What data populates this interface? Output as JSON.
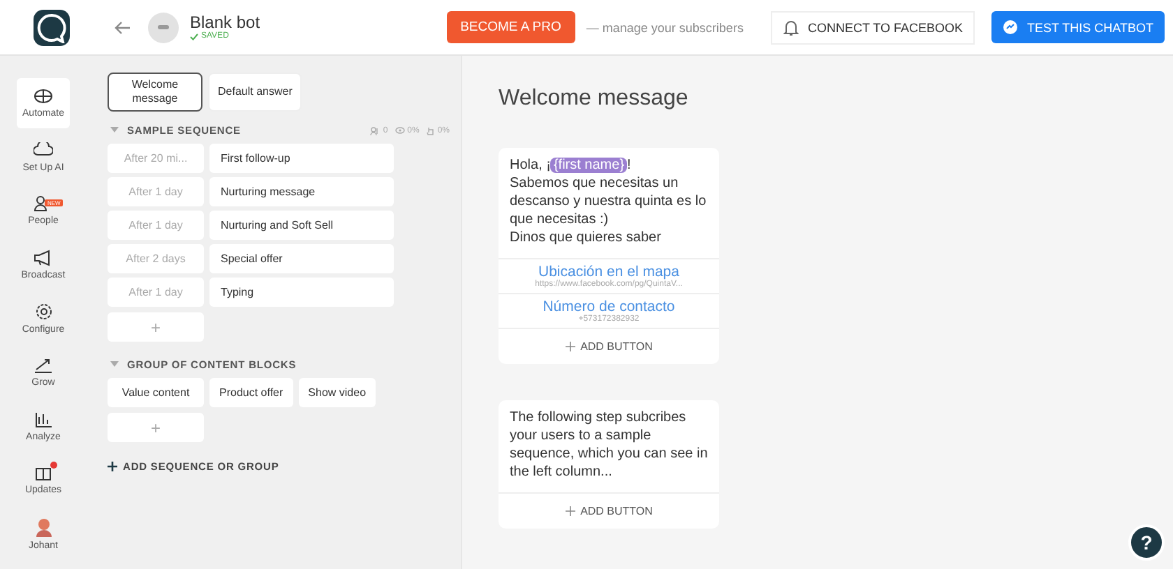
{
  "header": {
    "bot_name": "Blank bot",
    "status": "SAVED",
    "pro_button": "BECOME A PRO",
    "pro_hint": "— manage your subscribers",
    "connect_button": "CONNECT TO FACEBOOK",
    "test_button": "TEST THIS CHATBOT"
  },
  "nav": [
    {
      "label": "Automate",
      "selected": true
    },
    {
      "label": "Set Up AI",
      "selected": false
    },
    {
      "label": "People",
      "selected": false,
      "badge": "NEW"
    },
    {
      "label": "Broadcast",
      "selected": false
    },
    {
      "label": "Configure",
      "selected": false
    },
    {
      "label": "Grow",
      "selected": false
    },
    {
      "label": "Analyze",
      "selected": false
    },
    {
      "label": "Updates",
      "selected": false,
      "dot": true
    },
    {
      "label": "Johant",
      "selected": false
    }
  ],
  "top_blocks": [
    {
      "label": "Welcome message",
      "selected": true
    },
    {
      "label": "Default answer",
      "selected": false
    }
  ],
  "sequence": {
    "title": "SAMPLE SEQUENCE",
    "stats": [
      "0",
      "0%",
      "0%"
    ],
    "steps": [
      {
        "delay": "After 20 mi...",
        "name": "First follow-up"
      },
      {
        "delay": "After 1 day",
        "name": "Nurturing message"
      },
      {
        "delay": "After 1 day",
        "name": "Nurturing and Soft Sell"
      },
      {
        "delay": "After 2 days",
        "name": "Special offer"
      },
      {
        "delay": "After 1 day",
        "name": "Typing"
      }
    ],
    "add": "+"
  },
  "group": {
    "title": "GROUP OF CONTENT BLOCKS",
    "blocks": [
      "Value content",
      "Product offer",
      "Show video"
    ],
    "add": "+"
  },
  "add_sequence": "ADD SEQUENCE OR GROUP",
  "editor": {
    "title": "Welcome message",
    "cards": [
      {
        "text_before": "Hola, ¡",
        "variable": "{first name}",
        "text_after": "!\nSabemos que necesitas un descanso y nuestra quinta es lo que necesitas :)\nDinos que quieres saber",
        "buttons": [
          {
            "title": "Ubicación en el mapa",
            "subtitle": "https://www.facebook.com/pg/QuintaV..."
          },
          {
            "title": "Número de contacto",
            "subtitle": "+573172382932"
          }
        ],
        "add_button": "ADD BUTTON"
      },
      {
        "text_before": "The following step subcribes your users to a sample sequence, which you can see in the left column...",
        "add_button": "ADD BUTTON"
      }
    ]
  },
  "help": "?"
}
